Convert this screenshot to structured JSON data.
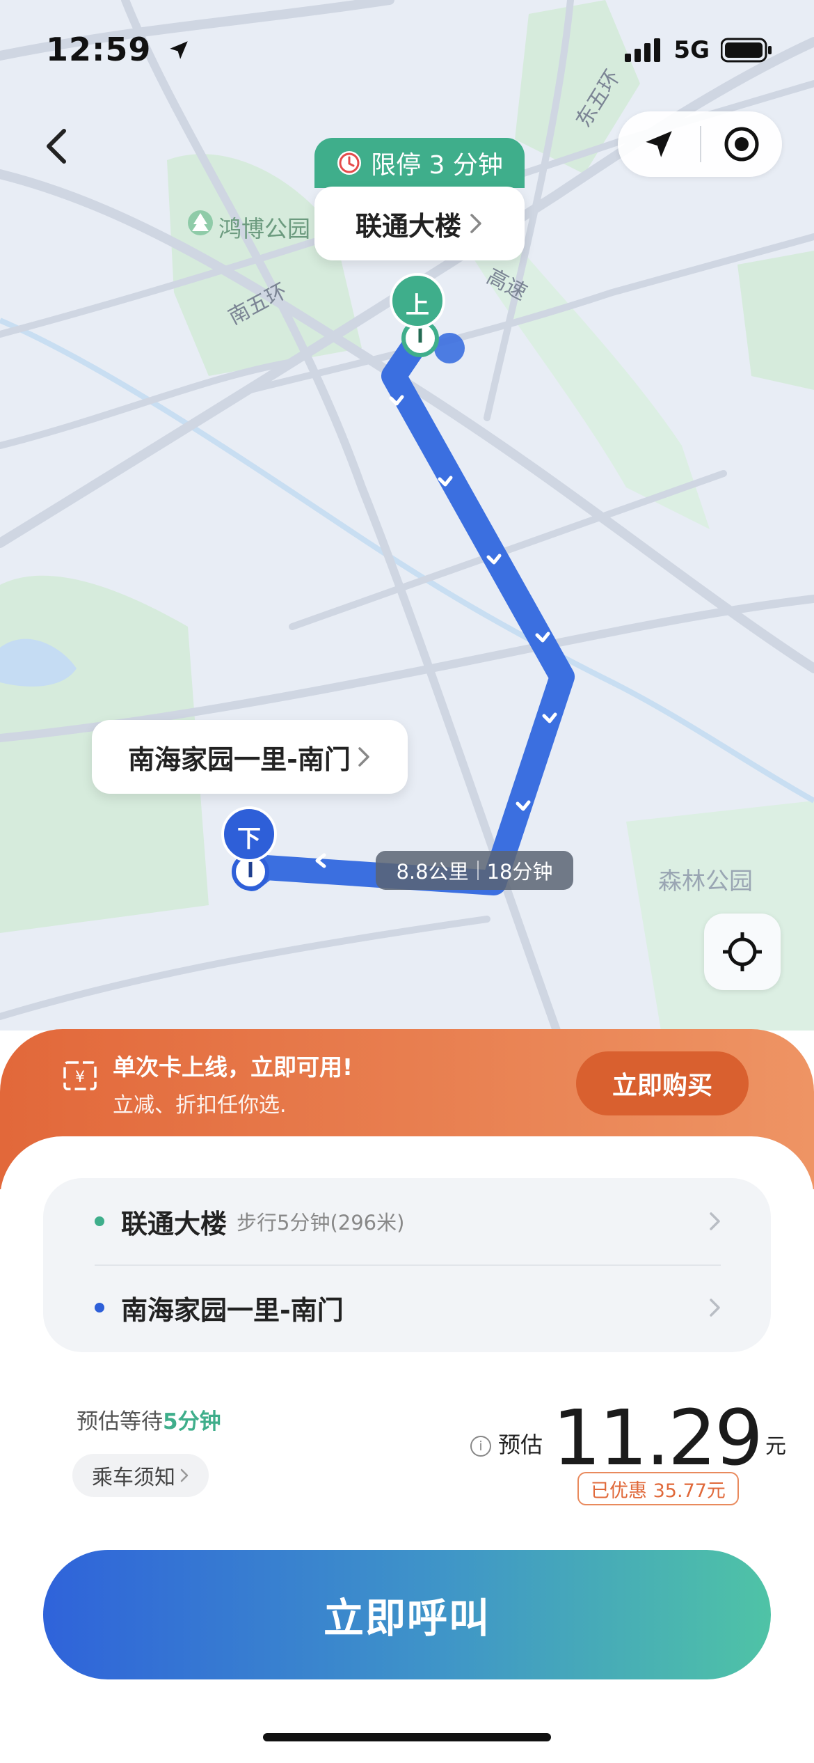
{
  "status_bar": {
    "time": "12:59",
    "network": "5G"
  },
  "map": {
    "road_labels": [
      "东五环",
      "南五环",
      "高速"
    ],
    "park_labels": [
      "鸿博公园",
      "森林公园"
    ],
    "pickup": {
      "stop_limit": "限停 3 分钟",
      "name": "联通大楼",
      "marker": "上"
    },
    "dropoff": {
      "name": "南海家园一里-南门",
      "marker": "下"
    },
    "route": {
      "distance": "8.8公里",
      "duration": "18分钟"
    }
  },
  "promo": {
    "title": "单次卡上线，立即可用!",
    "subtitle": "立减、折扣任你选.",
    "button": "立即购买"
  },
  "trip": {
    "from_name": "联通大楼",
    "from_walk": "步行5分钟(296米)",
    "to_name": "南海家园一里-南门",
    "wait_prefix": "预估等待",
    "wait_value": "5分钟",
    "notice": "乘车须知",
    "estimate_label": "预估",
    "price": "11.29",
    "currency": "元",
    "discount": "已优惠 35.77元",
    "call_button": "立即呼叫"
  },
  "colors": {
    "route": "#3b6fe0",
    "pickup_green": "#3fae8b",
    "promo_orange": "#e2683a",
    "dropoff_blue": "#2e5fd8"
  }
}
